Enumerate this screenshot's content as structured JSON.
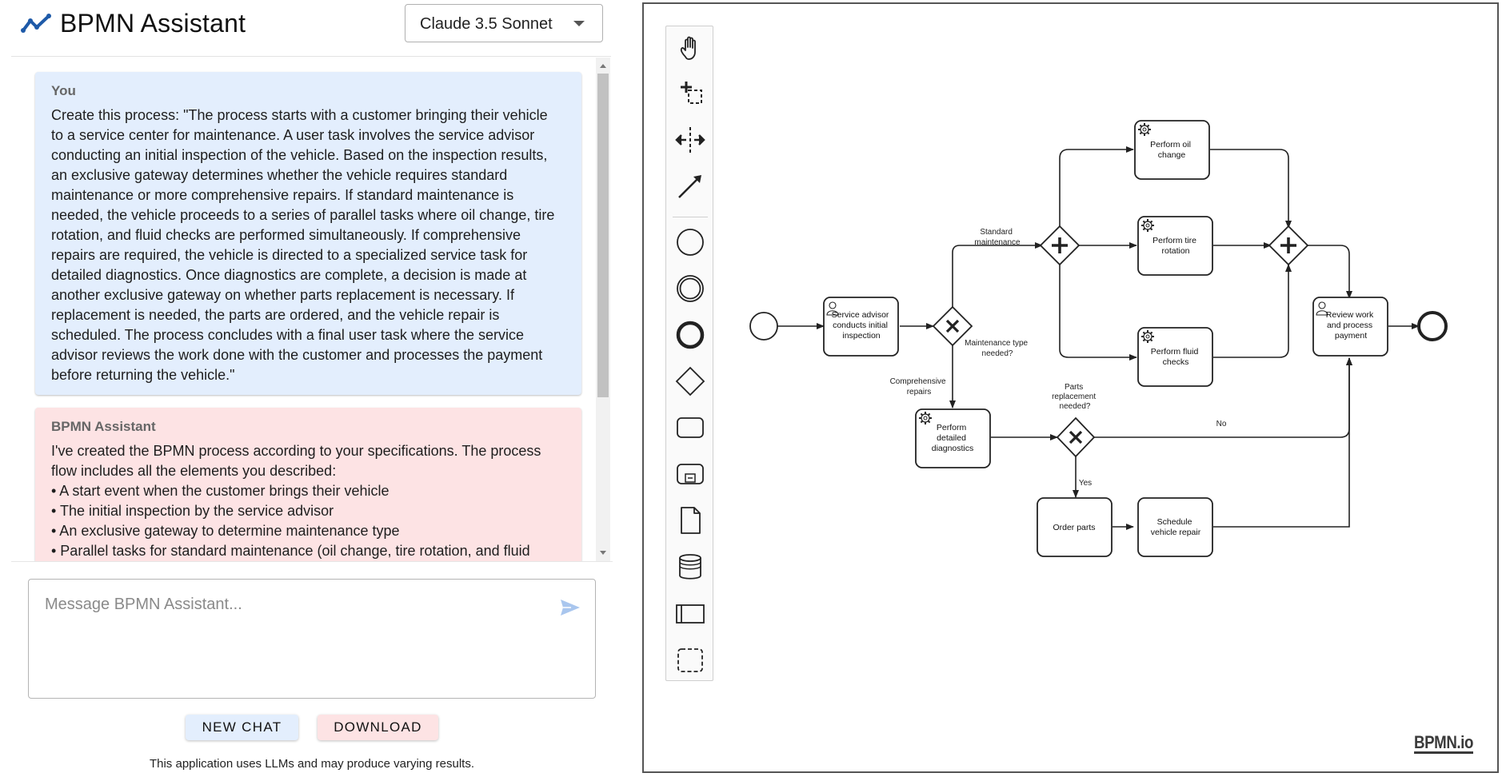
{
  "app": {
    "title": "BPMN Assistant",
    "model_selected": "Claude 3.5 Sonnet"
  },
  "chat": {
    "messages": [
      {
        "sender": "You",
        "lines": [
          "Create this process: \"The process starts with a customer bringing their vehicle",
          "to a service center for maintenance. A user task involves the service advisor",
          "conducting an initial inspection of the vehicle. Based on the inspection results,",
          "an exclusive gateway determines whether the vehicle requires standard",
          "maintenance or more comprehensive repairs. If standard maintenance is",
          "needed, the vehicle proceeds to a series of parallel tasks where oil change, tire",
          "rotation, and fluid checks are performed simultaneously. If comprehensive",
          "repairs are required, the vehicle is directed to a specialized service task for",
          "detailed diagnostics. Once diagnostics are complete, a decision is made at",
          "another exclusive gateway on whether parts replacement is necessary. If",
          "replacement is needed, the parts are ordered, and the vehicle repair is",
          "scheduled. The process concludes with a final user task where the service",
          "advisor reviews the work done with the customer and processes the payment",
          "before returning the vehicle.\""
        ]
      },
      {
        "sender": "BPMN Assistant",
        "lines": [
          "I've created the BPMN process according to your specifications. The process",
          "flow includes all the elements you described:",
          "• A start event when the customer brings their vehicle",
          "• The initial inspection by the service advisor",
          "• An exclusive gateway to determine maintenance type",
          "• Parallel tasks for standard maintenance (oil change, tire rotation, and fluid"
        ]
      }
    ]
  },
  "composer": {
    "placeholder": "Message BPMN Assistant..."
  },
  "buttons": {
    "new_chat": "NEW CHAT",
    "download": "DOWNLOAD"
  },
  "disclaimer": "This application uses LLMs and may produce varying results.",
  "diagram": {
    "tasks": {
      "inspection": [
        "Service advisor",
        "conducts initial",
        "inspection"
      ],
      "oil": [
        "Perform oil",
        "change"
      ],
      "tire": [
        "Perform tire",
        "rotation"
      ],
      "fluid": [
        "Perform fluid",
        "checks"
      ],
      "diagnostics": [
        "Perform",
        "detailed",
        "diagnostics"
      ],
      "order": [
        "Order parts"
      ],
      "schedule": [
        "Schedule",
        "vehicle repair"
      ],
      "review": [
        "Review work",
        "and process",
        "payment"
      ]
    },
    "labels": {
      "maint_gateway": [
        "Maintenance type",
        "needed?"
      ],
      "standard": [
        "Standard",
        "maintenance"
      ],
      "comprehensive": [
        "Comprehensive",
        "repairs"
      ],
      "parts_gateway": [
        "Parts",
        "replacement",
        "needed?"
      ],
      "no": "No",
      "yes": "Yes"
    }
  },
  "watermark": "BPMN.io",
  "palette_tools": [
    "hand-tool-icon",
    "lasso-tool-icon",
    "space-tool-icon",
    "connect-tool-icon",
    "start-event-icon",
    "intermediate-event-icon",
    "end-event-icon",
    "gateway-icon",
    "task-icon",
    "subprocess-icon",
    "data-object-icon",
    "data-store-icon",
    "participant-icon",
    "group-icon"
  ],
  "colors": {
    "user_bubble": "#e3eefd",
    "assistant_bubble": "#fde3e4",
    "accent": "#1e5aa8"
  }
}
